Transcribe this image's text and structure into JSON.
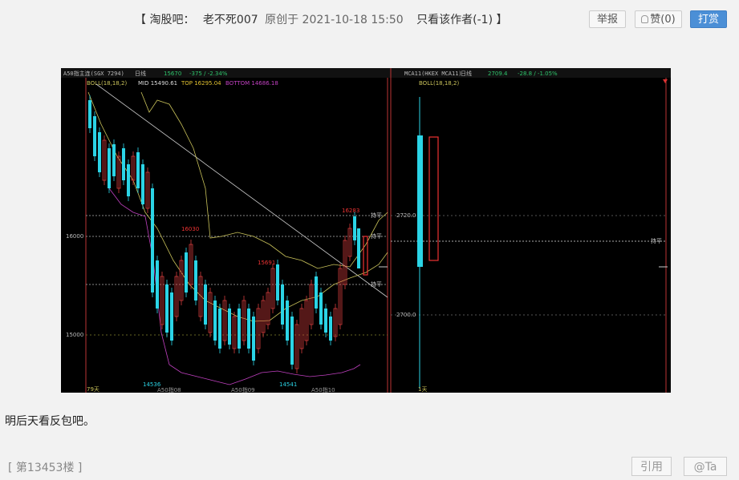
{
  "post": {
    "bracket_open": "【",
    "forum": "淘股吧：",
    "author": "老不死007",
    "meta": "原创于 2021-10-18 15:50",
    "only_author": "只看该作者(-1)",
    "bracket_close": "】"
  },
  "actions": {
    "report": "举报",
    "like": "赞(0)",
    "tip": "打赏",
    "like_icon": "lightbulb-icon"
  },
  "chart_left": {
    "title": "A50指主连(SGX 7294)",
    "period": "日线",
    "price": "15670",
    "change": "-375 / -2.34%",
    "indicator": "BOLL(18,18,2)",
    "mid": "MID 15490.61",
    "top": "TOP 16295.04",
    "bottom": "BOTTOM 14686.18",
    "annotations": [
      "16283",
      "16030",
      "15691",
      "14536",
      "14541"
    ],
    "y_ticks": [
      "16000",
      "15000"
    ],
    "level_label": "持平",
    "bottom_labels": [
      "79天",
      "A50指08",
      "A50指09",
      "A50指10"
    ]
  },
  "chart_right": {
    "title": "MCA11(HKEX MCA11)",
    "period": "日线",
    "price": "2709.4",
    "change": "-28.8 / -1.05%",
    "indicator": "BOLL(18,18,2)",
    "y_ticks": [
      "2720.0",
      "2700.0"
    ],
    "level_label": "持平",
    "bottom_label": "1天"
  },
  "body_text": "明后天看反包吧。",
  "footer": {
    "floor": "[ 第13453楼 ]",
    "quote": "引用",
    "at": "@Ta"
  },
  "colors": {
    "up": "#d23b3b",
    "down": "#2bd4e6",
    "boll": "#c9c25a",
    "background": "#000000"
  }
}
